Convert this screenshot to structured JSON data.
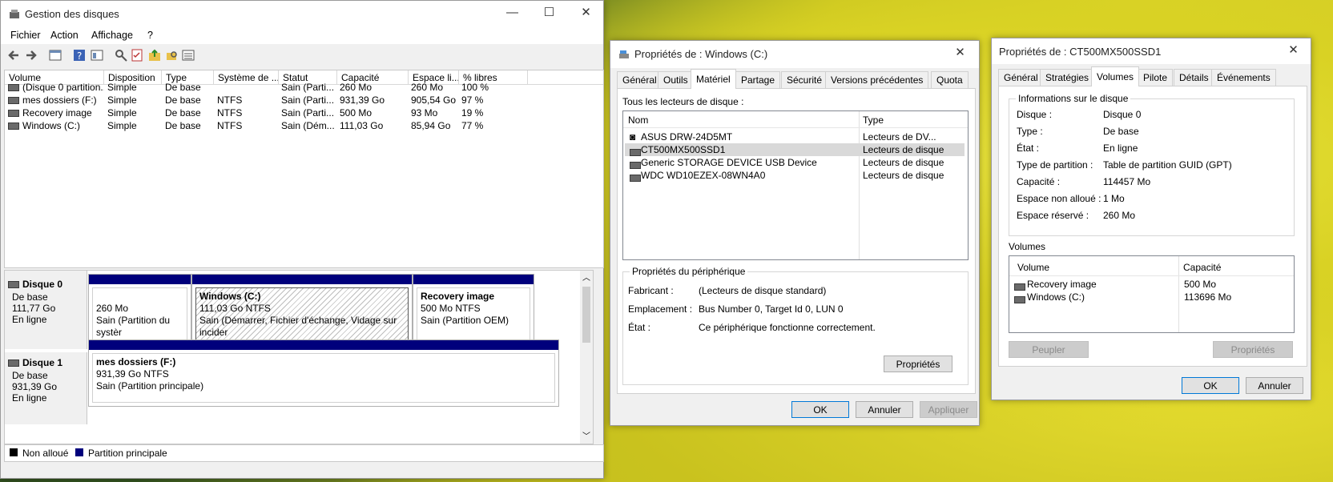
{
  "dm": {
    "title": "Gestion des disques",
    "menus": [
      "Fichier",
      "Action",
      "Affichage",
      "?"
    ],
    "columns": [
      "Volume",
      "Disposition",
      "Type",
      "Système de ...",
      "Statut",
      "Capacité",
      "Espace li...",
      "% libres"
    ],
    "rows": [
      [
        "(Disque 0 partition...",
        "Simple",
        "De base",
        "",
        "Sain (Parti...",
        "260 Mo",
        "260 Mo",
        "100 %"
      ],
      [
        "mes dossiers (F:)",
        "Simple",
        "De base",
        "NTFS",
        "Sain (Parti...",
        "931,39 Go",
        "905,54 Go",
        "97 %"
      ],
      [
        "Recovery image",
        "Simple",
        "De base",
        "NTFS",
        "Sain (Parti...",
        "500 Mo",
        "93 Mo",
        "19 %"
      ],
      [
        "Windows (C:)",
        "Simple",
        "De base",
        "NTFS",
        "Sain (Dém...",
        "111,03 Go",
        "85,94 Go",
        "77 %"
      ]
    ],
    "disk0": {
      "name": "Disque 0",
      "type": "De base",
      "size": "111,77 Go",
      "status": "En ligne",
      "p1": {
        "size": "260 Mo",
        "status": "Sain (Partition du systèr"
      },
      "p2": {
        "name": "Windows  (C:)",
        "size": "111,03 Go NTFS",
        "status": "Sain (Démarrer, Fichier d'échange, Vidage sur incider"
      },
      "p3": {
        "name": "Recovery image",
        "size": "500 Mo NTFS",
        "status": "Sain (Partition OEM)"
      }
    },
    "disk1": {
      "name": "Disque 1",
      "type": "De base",
      "size": "931,39 Go",
      "status": "En ligne",
      "p1": {
        "name": "mes dossiers  (F:)",
        "size": "931,39 Go NTFS",
        "status": "Sain (Partition principale)"
      }
    },
    "legend": {
      "unallocated": "Non alloué",
      "primary": "Partition principale"
    },
    "colors": {
      "primary": "#00007c",
      "unallocated": "#000000"
    }
  },
  "pc": {
    "title": "Propriétés de : Windows (C:)",
    "tabs": [
      "Général",
      "Outils",
      "Matériel",
      "Partage",
      "Sécurité",
      "Versions précédentes",
      "Quota"
    ],
    "active_tab": "Matériel",
    "list_label": "Tous les lecteurs de disque :",
    "columns": [
      "Nom",
      "Type"
    ],
    "drives": [
      {
        "name": "ASUS DRW-24D5MT",
        "type": "Lecteurs de DV..."
      },
      {
        "name": "CT500MX500SSD1",
        "type": "Lecteurs de disque"
      },
      {
        "name": "Generic STORAGE DEVICE USB Device",
        "type": "Lecteurs de disque"
      },
      {
        "name": "WDC WD10EZEX-08WN4A0",
        "type": "Lecteurs de disque"
      }
    ],
    "props_group": "Propriétés du périphérique",
    "fabricant_label": "Fabricant :",
    "fabricant": "(Lecteurs de disque standard)",
    "emplacement_label": "Emplacement :",
    "emplacement": "Bus Number 0, Target Id 0, LUN 0",
    "etat_label": "État :",
    "etat": "Ce périphérique fonctionne correctement.",
    "props_btn": "Propriétés",
    "ok": "OK",
    "cancel": "Annuler",
    "apply": "Appliquer"
  },
  "pd": {
    "title": "Propriétés de : CT500MX500SSD1",
    "tabs": [
      "Général",
      "Stratégies",
      "Volumes",
      "Pilote",
      "Détails",
      "Événements"
    ],
    "active_tab": "Volumes",
    "info_group": "Informations sur le disque",
    "info": [
      {
        "label": "Disque :",
        "value": "Disque 0"
      },
      {
        "label": "Type :",
        "value": "De base"
      },
      {
        "label": "État :",
        "value": "En ligne"
      },
      {
        "label": "Type de partition :",
        "value": "Table de partition GUID (GPT)"
      },
      {
        "label": "Capacité :",
        "value": "114457 Mo"
      },
      {
        "label": "Espace non alloué :",
        "value": "1 Mo"
      },
      {
        "label": "Espace réservé :",
        "value": "260 Mo"
      }
    ],
    "volumes_label": "Volumes",
    "vol_columns": [
      "Volume",
      "Capacité"
    ],
    "volumes": [
      {
        "name": "Recovery image",
        "cap": "500 Mo"
      },
      {
        "name": "Windows (C:)",
        "cap": "113696 Mo"
      }
    ],
    "populate": "Peupler",
    "props": "Propriétés",
    "ok": "OK",
    "cancel": "Annuler"
  }
}
